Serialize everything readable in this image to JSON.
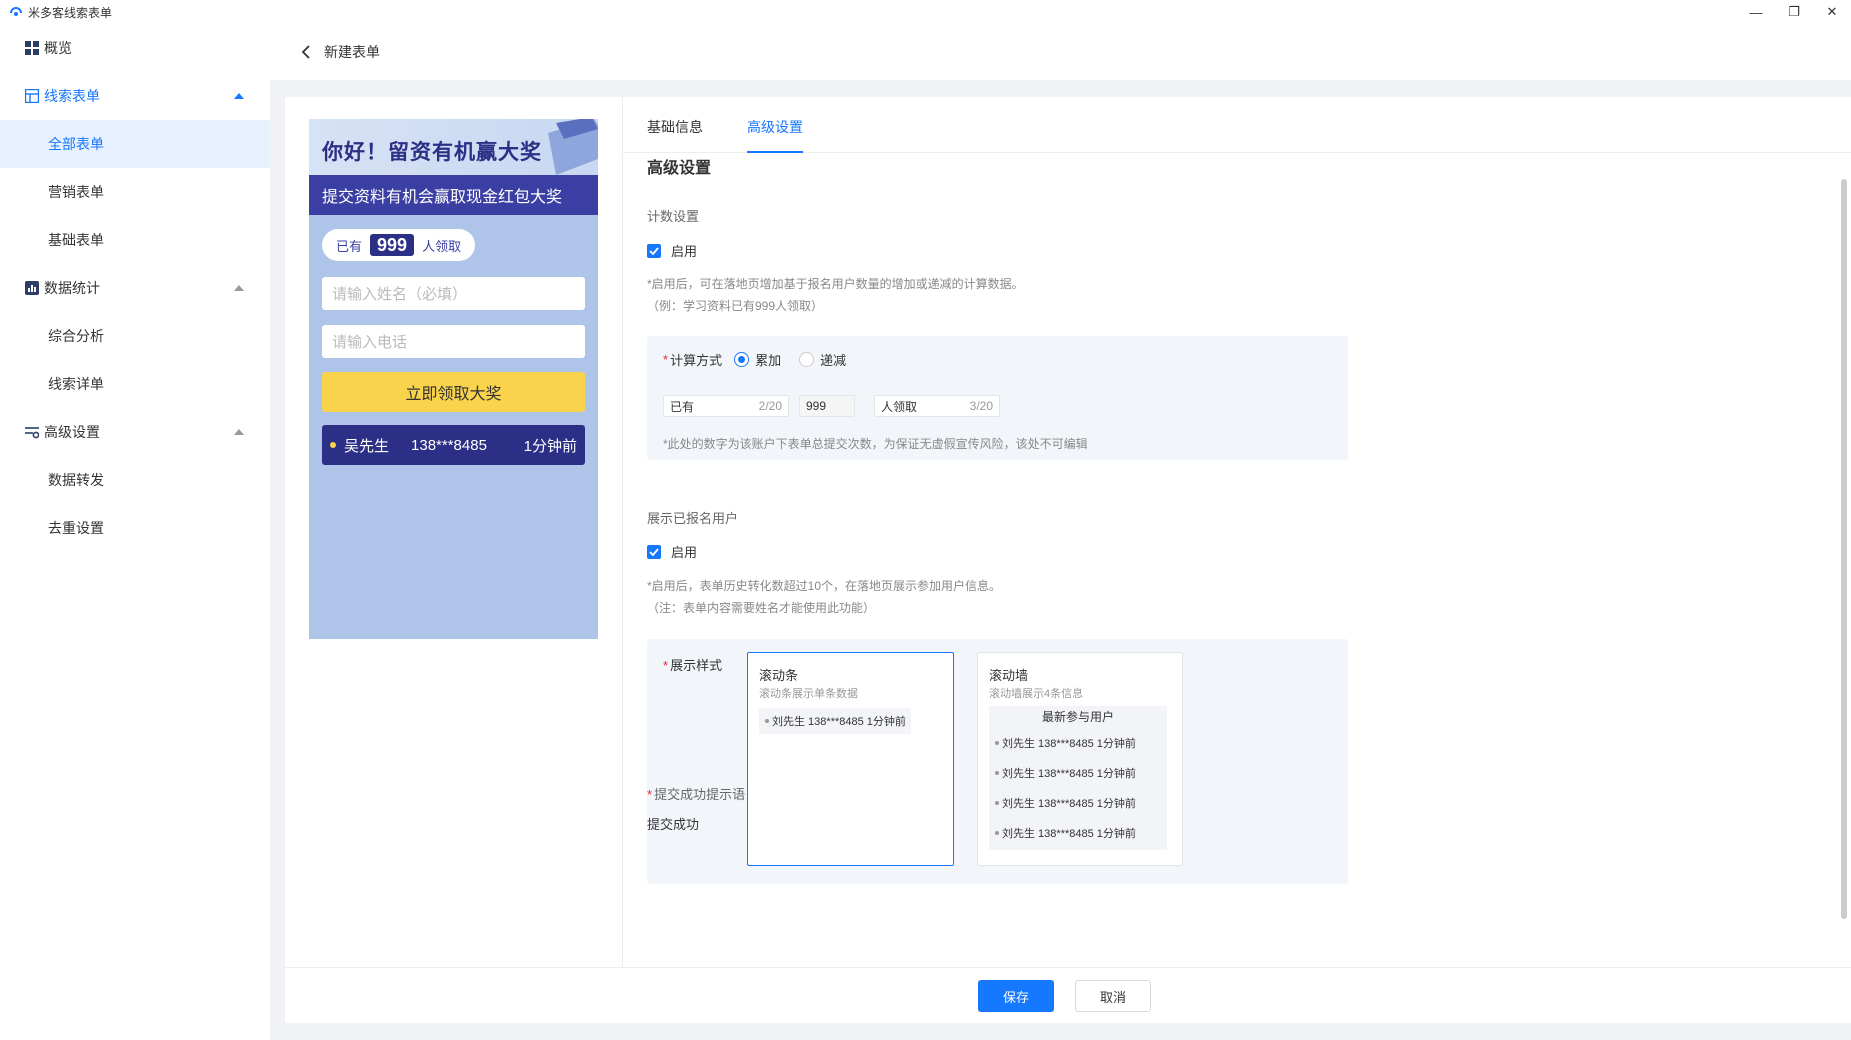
{
  "window": {
    "title": "米多客线索表单",
    "controls": [
      "—",
      "❐",
      "✕"
    ]
  },
  "sidebar": {
    "overview": "概览",
    "lead_forms": {
      "label": "线索表单",
      "items": [
        "全部表单",
        "营销表单",
        "基础表单"
      ]
    },
    "data_stats": {
      "label": "数据统计",
      "items": [
        "综合分析",
        "线索详单"
      ]
    },
    "advanced": {
      "label": "高级设置",
      "items": [
        "数据转发",
        "去重设置"
      ]
    }
  },
  "header": {
    "title": "新建表单"
  },
  "preview": {
    "banner_title": "你好！留资有机赢大奖",
    "banner_subtitle": "提交资料有机会赢取现金红包大奖",
    "count_prefix": "已有",
    "count_number": "999",
    "count_suffix": "人领取",
    "name_placeholder": "请输入姓名（必填）",
    "phone_placeholder": "请输入电话",
    "submit_label": "立即领取大奖",
    "ticker": {
      "name": "吴先生",
      "phone": "138***8485",
      "time": "1分钟前"
    }
  },
  "tabs": [
    "基础信息",
    "高级设置"
  ],
  "settings": {
    "section_title": "高级设置",
    "counter": {
      "label": "计数设置",
      "enable_label": "启用",
      "hint_line1": "*启用后，可在落地页增加基于报名用户数量的增加或递减的计算数据。",
      "hint_line2": "（例：学习资料已有999人领取）",
      "method_label": "计算方式",
      "method_options": [
        "累加",
        "递减"
      ],
      "prefix_value": "已有",
      "prefix_count": "2/20",
      "number_value": "999",
      "suffix_value": "人领取",
      "suffix_count": "3/20",
      "box_hint": "*此处的数字为该账户下表单总提交次数，为保证无虚假宣传风险，该处不可编辑"
    },
    "show_users": {
      "label": "展示已报名用户",
      "enable_label": "启用",
      "hint_line1": "*启用后，表单历史转化数超过10个，在落地页展示参加用户信息。",
      "hint_line2": "（注：表单内容需要姓名才能使用此功能）",
      "style_label": "展示样式",
      "styles": [
        {
          "title": "滚动条",
          "desc": "滚动条展示单条数据",
          "row": "刘先生 138***8485 1分钟前"
        },
        {
          "title": "滚动墙",
          "desc": "滚动墙展示4条信息",
          "header": "最新参与用户",
          "rows": [
            "刘先生 138***8485 1分钟前",
            "刘先生 138***8485 1分钟前",
            "刘先生 138***8485 1分钟前",
            "刘先生 138***8485 1分钟前"
          ]
        }
      ]
    },
    "success": {
      "label": "提交成功提示语",
      "value": "提交成功"
    }
  },
  "footer": {
    "save": "保存",
    "cancel": "取消"
  }
}
